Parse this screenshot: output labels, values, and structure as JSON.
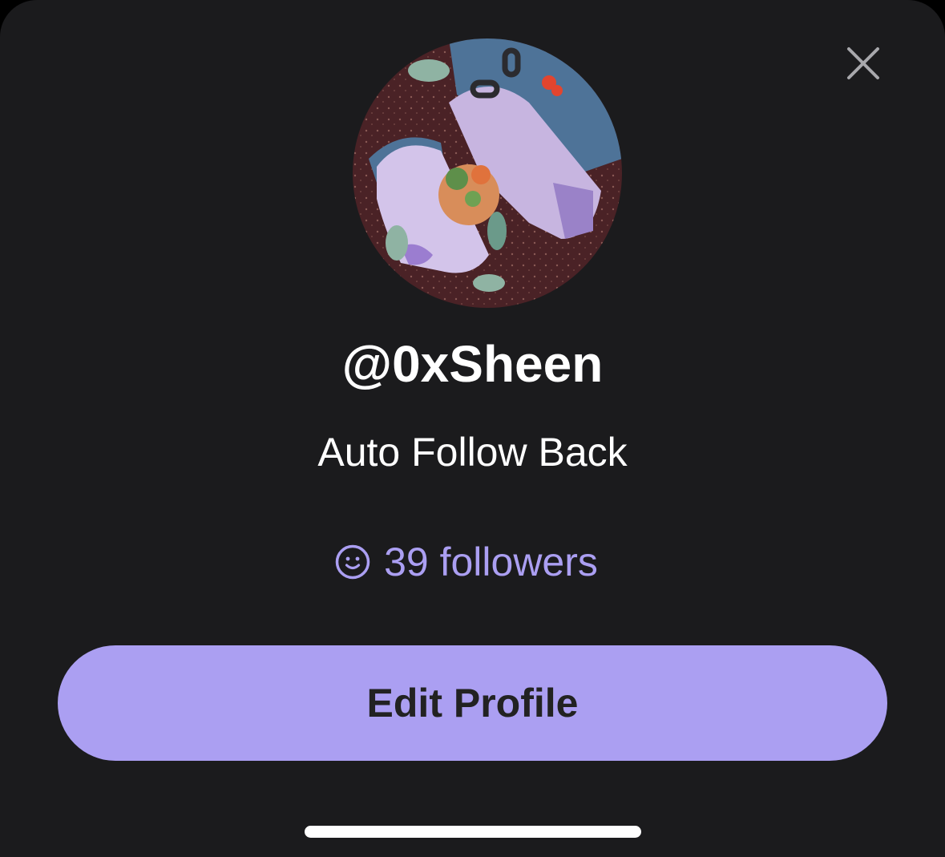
{
  "profile": {
    "username": "@0xSheen",
    "bio": "Auto Follow Back",
    "followers_label": "39 followers",
    "followers_count": 39,
    "avatar_description": "avatar-image"
  },
  "actions": {
    "edit_profile_label": "Edit Profile",
    "close_icon": "close-icon",
    "followers_icon": "smiley-icon"
  },
  "colors": {
    "sheet_background": "#1b1b1d",
    "accent": "#ab9ff2",
    "button_text": "#222222",
    "text_primary": "#ffffff"
  }
}
